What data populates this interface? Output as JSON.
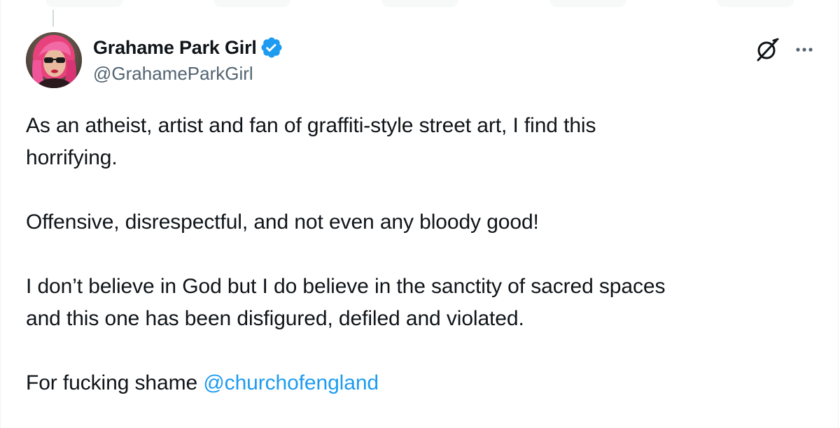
{
  "tweet": {
    "author": {
      "display_name": "Grahame Park Girl",
      "handle": "@GrahameParkGirl",
      "verified": true,
      "verified_icon": "verified-badge-icon",
      "avatar_icon": "avatar-photo"
    },
    "header_icons": {
      "grok": "grok-icon",
      "more": "more-options-icon"
    },
    "body": {
      "line1": "As an atheist, artist and fan of graffiti-style street art, I find this",
      "line2": "horrifying.",
      "line3": "Offensive, disrespectful, and not even any bloody good!",
      "line4": "I don’t believe in God but I do believe in the sanctity of sacred spaces",
      "line5": "and this one has been disfigured, defiled and violated.",
      "line6_prefix": "For fucking shame ",
      "mention": "@churchofengland"
    }
  },
  "colors": {
    "text_primary": "#0f1419",
    "text_secondary": "#536471",
    "accent": "#1d9bf0",
    "border": "#eff3f4"
  }
}
